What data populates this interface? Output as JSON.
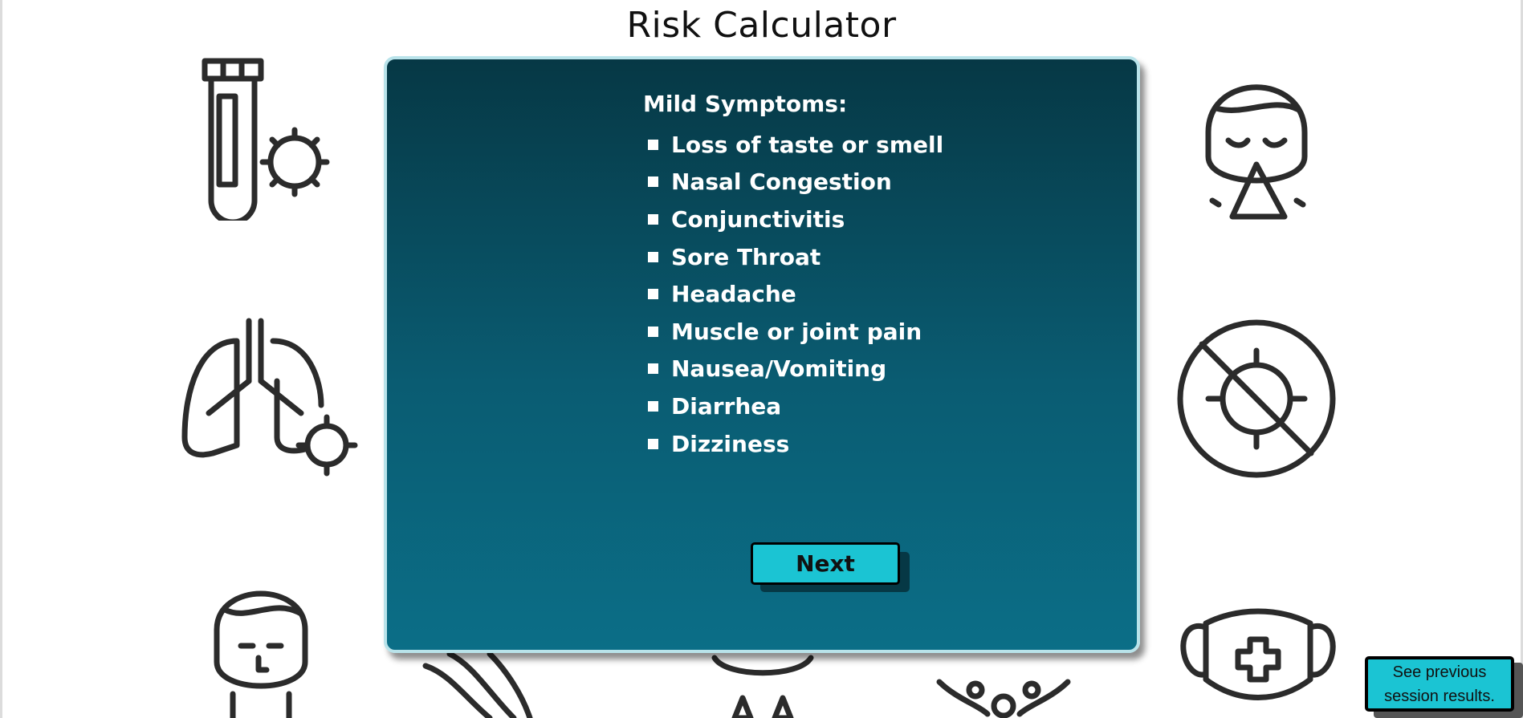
{
  "page": {
    "title": "Risk Calculator"
  },
  "card": {
    "heading": "Mild Symptoms:",
    "symptoms": [
      "Loss of taste or smell",
      "Nasal Congestion",
      "Conjunctivitis",
      "Sore Throat",
      "Headache",
      "Muscle or joint pain",
      "Nausea/Vomiting",
      "Diarrhea",
      "Dizziness"
    ],
    "next_label": "Next"
  },
  "footer": {
    "previous_results_label": "See previous session results."
  },
  "colors": {
    "card_top": "#063845",
    "card_bottom": "#0b6e87",
    "card_border": "#b9e3ea",
    "button": "#1bc4d3"
  },
  "background_icons": [
    "test-tube-virus-icon",
    "lungs-virus-icon",
    "person-rash-icon",
    "hand-icon",
    "droplets-icon",
    "virus-icon",
    "person-sneeze-icon",
    "no-virus-icon",
    "face-mask-icon"
  ]
}
